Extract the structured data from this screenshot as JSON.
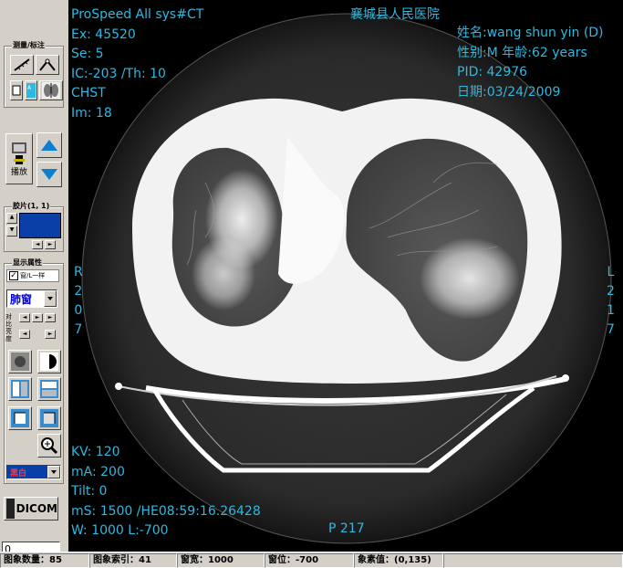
{
  "toolbar": {
    "measure_group": "测量/标注",
    "play_label": "播放",
    "film_group": "胶片(1, 1)",
    "display_group": "显示属性",
    "sync_label": "窗/L一样",
    "window_preset": "肺窗",
    "contrast_label": "对比",
    "brightness_label": "亮度",
    "color_preset": "黑白",
    "dicom_label": "DICOM",
    "frame_input_value": "0"
  },
  "overlay": {
    "top_left": [
      "ProSpeed All  sys#CT",
      "Ex: 45520",
      "Se: 5",
      "IC:-203 /Th: 10",
      "CHST",
      "Im: 18"
    ],
    "hospital": "襄城县人民医院",
    "top_right": [
      "姓名:wang shun yin (D)",
      "性别:M  年龄:62 years",
      "PID: 42976",
      "日期:03/24/2009"
    ],
    "left_orient": [
      "R",
      "2",
      "0",
      "7"
    ],
    "right_orient": [
      "L",
      "2",
      "1",
      "7"
    ],
    "bottom_left": [
      "KV: 120",
      "mA: 200",
      "Tilt: 0",
      "mS: 1500  /HE08:59:16.26428",
      "W: 1000 L:-700"
    ],
    "bottom_center": "P 217"
  },
  "status": {
    "image_count": "图象数量：85",
    "image_index": "图象索引：41",
    "window_width": "窗宽：1000",
    "window_level": "窗位：-700",
    "pixel_value": "象素值：(0,135)"
  },
  "colors": {
    "overlay_text": "#2fb8e0",
    "arrow_blue": "#0b7fd1",
    "film_blue": "#0a3fa8"
  }
}
